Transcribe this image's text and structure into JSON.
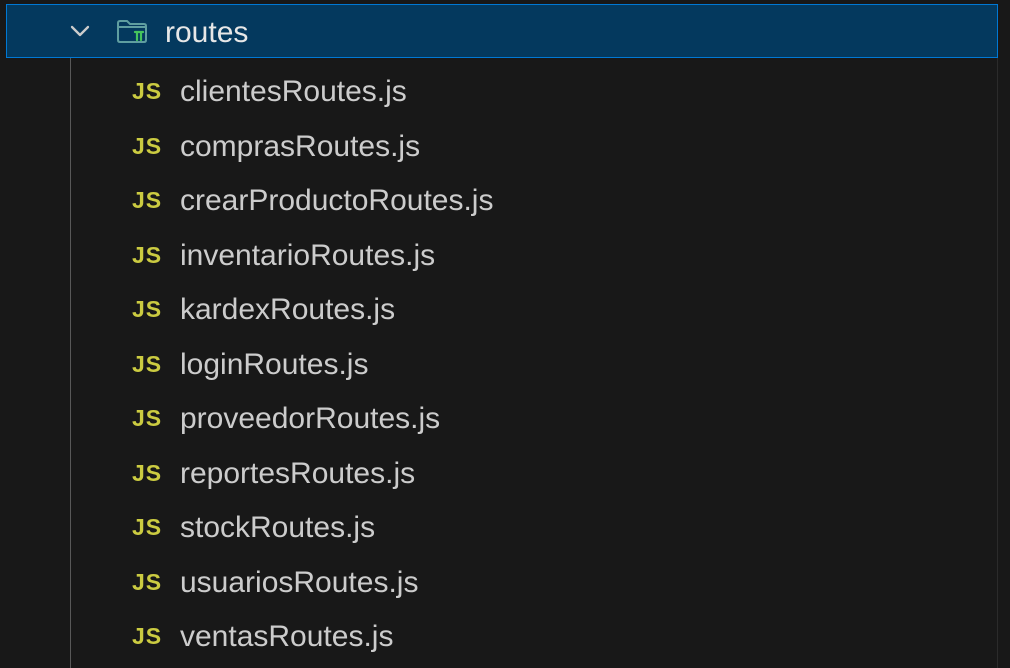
{
  "folder": {
    "name": "routes",
    "expanded_icon": "chevron-down-icon",
    "folder_icon": "folder-routes-icon"
  },
  "files": [
    {
      "badge": "JS",
      "name": "clientesRoutes.js"
    },
    {
      "badge": "JS",
      "name": "comprasRoutes.js"
    },
    {
      "badge": "JS",
      "name": "crearProductoRoutes.js"
    },
    {
      "badge": "JS",
      "name": "inventarioRoutes.js"
    },
    {
      "badge": "JS",
      "name": "kardexRoutes.js"
    },
    {
      "badge": "JS",
      "name": "loginRoutes.js"
    },
    {
      "badge": "JS",
      "name": "proveedorRoutes.js"
    },
    {
      "badge": "JS",
      "name": "reportesRoutes.js"
    },
    {
      "badge": "JS",
      "name": "stockRoutes.js"
    },
    {
      "badge": "JS",
      "name": "usuariosRoutes.js"
    },
    {
      "badge": "JS",
      "name": "ventasRoutes.js"
    }
  ],
  "colors": {
    "background": "#181818",
    "selected_row": "#04395e",
    "focus_border": "#0078d4",
    "js_badge": "#cbcb41",
    "file_text": "#cccccc",
    "folder_icon": "#5f9ea0",
    "folder_route_mark": "#45c45d"
  }
}
